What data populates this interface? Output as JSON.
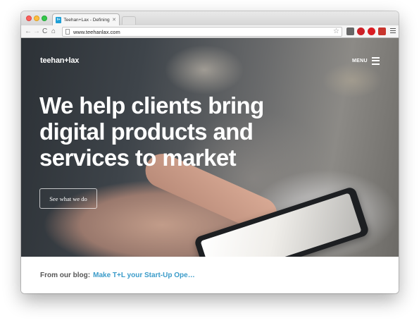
{
  "browser": {
    "tab": {
      "title": "Teehan+Lax - Defining Exp",
      "close": "✕",
      "favicon": "t+"
    },
    "url": "www.teehanlax.com",
    "nav": {
      "back": "←",
      "forward": "→",
      "reload": "C",
      "home": "⌂"
    },
    "star": "☆"
  },
  "site": {
    "logo": "teehan+lax",
    "menu_label": "MENU",
    "headline": "We help clients bring digital products and services to market",
    "cta": "See what we do",
    "blog_label": "From our blog:",
    "blog_link": "Make T+L your Start-Up Ope",
    "blog_ellipsis": "…"
  },
  "colors": {
    "accent": "#3a9bc9",
    "hero_text": "#ffffff"
  },
  "icons": [
    "close-dot",
    "minimize-dot",
    "maximize-dot",
    "page-icon",
    "star-icon",
    "pocket-icon",
    "pinterest-icon",
    "opera-icon",
    "extension-icon",
    "menu-icon",
    "hamburger-icon"
  ]
}
